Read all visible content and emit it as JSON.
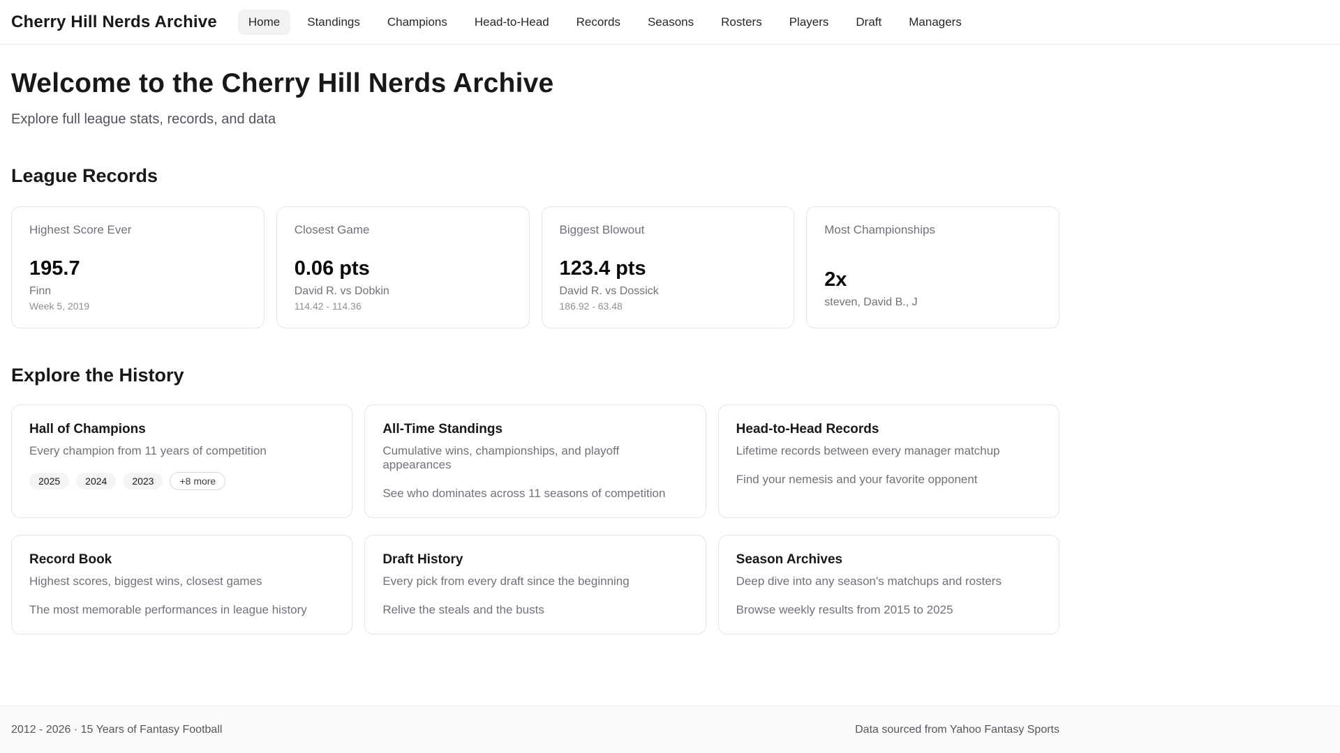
{
  "header": {
    "title": "Cherry Hill Nerds Archive",
    "nav": [
      {
        "label": "Home",
        "active": true
      },
      {
        "label": "Standings",
        "active": false
      },
      {
        "label": "Champions",
        "active": false
      },
      {
        "label": "Head-to-Head",
        "active": false
      },
      {
        "label": "Records",
        "active": false
      },
      {
        "label": "Seasons",
        "active": false
      },
      {
        "label": "Rosters",
        "active": false
      },
      {
        "label": "Players",
        "active": false
      },
      {
        "label": "Draft",
        "active": false
      },
      {
        "label": "Managers",
        "active": false
      }
    ]
  },
  "hero": {
    "title": "Welcome to the Cherry Hill Nerds Archive",
    "subtitle": "Explore full league stats, records, and data"
  },
  "records": {
    "heading": "League Records",
    "cards": [
      {
        "label": "Highest Score Ever",
        "value": "195.7",
        "line1": "Finn",
        "line2": "Week 5, 2019"
      },
      {
        "label": "Closest Game",
        "value": "0.06 pts",
        "line1": "David R. vs Dobkin",
        "line2": "114.42 - 114.36"
      },
      {
        "label": "Biggest Blowout",
        "value": "123.4 pts",
        "line1": "David R. vs Dossick",
        "line2": "186.92 - 63.48"
      },
      {
        "label": "Most Championships",
        "value": "2x",
        "line1": "steven, David B., J",
        "line2": ""
      }
    ]
  },
  "history": {
    "heading": "Explore the History",
    "cards": [
      {
        "title": "Hall of Champions",
        "desc": "Every champion from 11 years of competition",
        "badges": [
          "2025",
          "2024",
          "2023"
        ],
        "more_badge": "+8 more"
      },
      {
        "title": "All-Time Standings",
        "desc": "Cumulative wins, championships, and playoff appearances",
        "note": "See who dominates across 11 seasons of competition"
      },
      {
        "title": "Head-to-Head Records",
        "desc": "Lifetime records between every manager matchup",
        "note": "Find your nemesis and your favorite opponent"
      },
      {
        "title": "Record Book",
        "desc": "Highest scores, biggest wins, closest games",
        "note": "The most memorable performances in league history"
      },
      {
        "title": "Draft History",
        "desc": "Every pick from every draft since the beginning",
        "note": "Relive the steals and the busts"
      },
      {
        "title": "Season Archives",
        "desc": "Deep dive into any season's matchups and rosters",
        "note": "Browse weekly results from 2015 to 2025"
      }
    ]
  },
  "footer": {
    "left": "2012 - 2026 · 15 Years of Fantasy Football",
    "right": "Data sourced from Yahoo Fantasy Sports"
  },
  "colors": {
    "active_nav_bg": "#f2f2f3",
    "card_border": "#e4e4e7",
    "text_primary": "#18181b",
    "text_muted": "#71717a",
    "footer_bg": "#fafafa"
  }
}
